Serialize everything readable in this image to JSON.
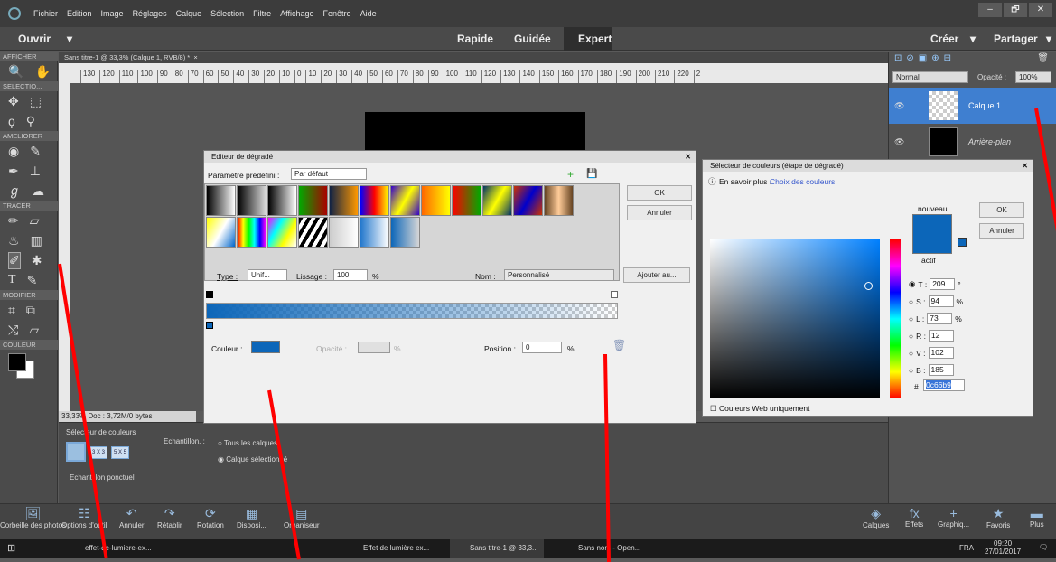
{
  "menu": {
    "items": [
      "Fichier",
      "Edition",
      "Image",
      "Réglages",
      "Calque",
      "Sélection",
      "Filtre",
      "Affichage",
      "Fenêtre",
      "Aide"
    ],
    "win_controls": [
      "–",
      "🗗",
      "✕"
    ]
  },
  "modebar": {
    "open": "Ouvrir",
    "open_arrow": "▾",
    "quick": "Rapide",
    "guided": "Guidée",
    "expert": "Expert",
    "create": "Créer",
    "create_arrow": "▾",
    "share": "Partager",
    "share_arrow": "▾"
  },
  "toolbox": {
    "afficher": "AFFICHER",
    "selection": "SELECTIO...",
    "ameliorer": "AMELIORER",
    "tracer": "TRACER",
    "modifier": "MODIFIER",
    "couleur": "COULEUR"
  },
  "doc": {
    "tab": "Sans titre-1 @ 33,3% (Calque 1, RVB/8) *",
    "close": "×",
    "ruler": [
      "130",
      "120",
      "110",
      "100",
      "90",
      "80",
      "70",
      "60",
      "50",
      "40",
      "30",
      "20",
      "10",
      "0",
      "10",
      "20",
      "30",
      "40",
      "50",
      "60",
      "70",
      "80",
      "90",
      "100",
      "110",
      "120",
      "130",
      "140",
      "150",
      "160",
      "170",
      "180",
      "190",
      "200",
      "210",
      "220",
      "2"
    ],
    "status": "33,33%      Doc : 3,72M/0 bytes"
  },
  "options": {
    "title": "Sélecteur de couleurs",
    "sample": "Echantillon. :",
    "all_layers": "Tous les calques",
    "selected_layer": "Calque sélectionné",
    "b1": "3 X 3",
    "b2": "5 X 5",
    "point": "Echantillon ponctuel"
  },
  "layers": {
    "blend": "Normal",
    "opacity_label": "Opacité :",
    "opacity": "100%",
    "layer1": "Calque 1",
    "background": "Arrière-plan"
  },
  "gradient_editor": {
    "title": "Editeur de dégradé",
    "preset_label": "Paramètre prédéfini :",
    "preset": "Par défaut",
    "ok": "OK",
    "cancel": "Annuler",
    "type_label": "Type :",
    "type": "Unif...",
    "smooth_label": "Lissage :",
    "smooth": "100",
    "pct": "%",
    "name_label": "Nom :",
    "name": "Personnalisé",
    "add": "Ajouter au...",
    "color_label": "Couleur :",
    "opacity_label": "Opacité :",
    "position_label": "Position :",
    "position": "0",
    "pct2": "%",
    "pct3": "%",
    "color": "#0c66b9"
  },
  "color_picker": {
    "title": "Sélecteur de couleurs (étape de dégradé)",
    "learn": "En savoir plus :",
    "learn_link": "Choix des couleurs",
    "new": "nouveau",
    "current": "actif",
    "ok": "OK",
    "cancel": "Annuler",
    "fields": [
      {
        "l": "T :",
        "v": "209",
        "u": "°"
      },
      {
        "l": "S :",
        "v": "94",
        "u": "%"
      },
      {
        "l": "L :",
        "v": "73",
        "u": "%"
      },
      {
        "l": "R :",
        "v": "12",
        "u": ""
      },
      {
        "l": "V :",
        "v": "102",
        "u": ""
      },
      {
        "l": "B :",
        "v": "185",
        "u": ""
      }
    ],
    "hash": "#",
    "hex": "0c66b9",
    "web_only": "Couleurs Web uniquement"
  },
  "bottom": {
    "items": [
      "Corbeille des photos",
      "Options d'outil",
      "Annuler",
      "Rétablir",
      "Rotation",
      "Disposi...",
      "Organiseur"
    ],
    "right": [
      "Calques",
      "Effets",
      "Graphiq...",
      "Favoris",
      "Plus"
    ]
  },
  "taskbar": {
    "apps": [
      "effet-de-lumiere-ex...",
      "Effet de lumière ex...",
      "Sans titre-1 @ 33,3...",
      "Sans nom - Open..."
    ],
    "time": "09:20",
    "date": "27/01/2017",
    "lang": "FRA"
  }
}
